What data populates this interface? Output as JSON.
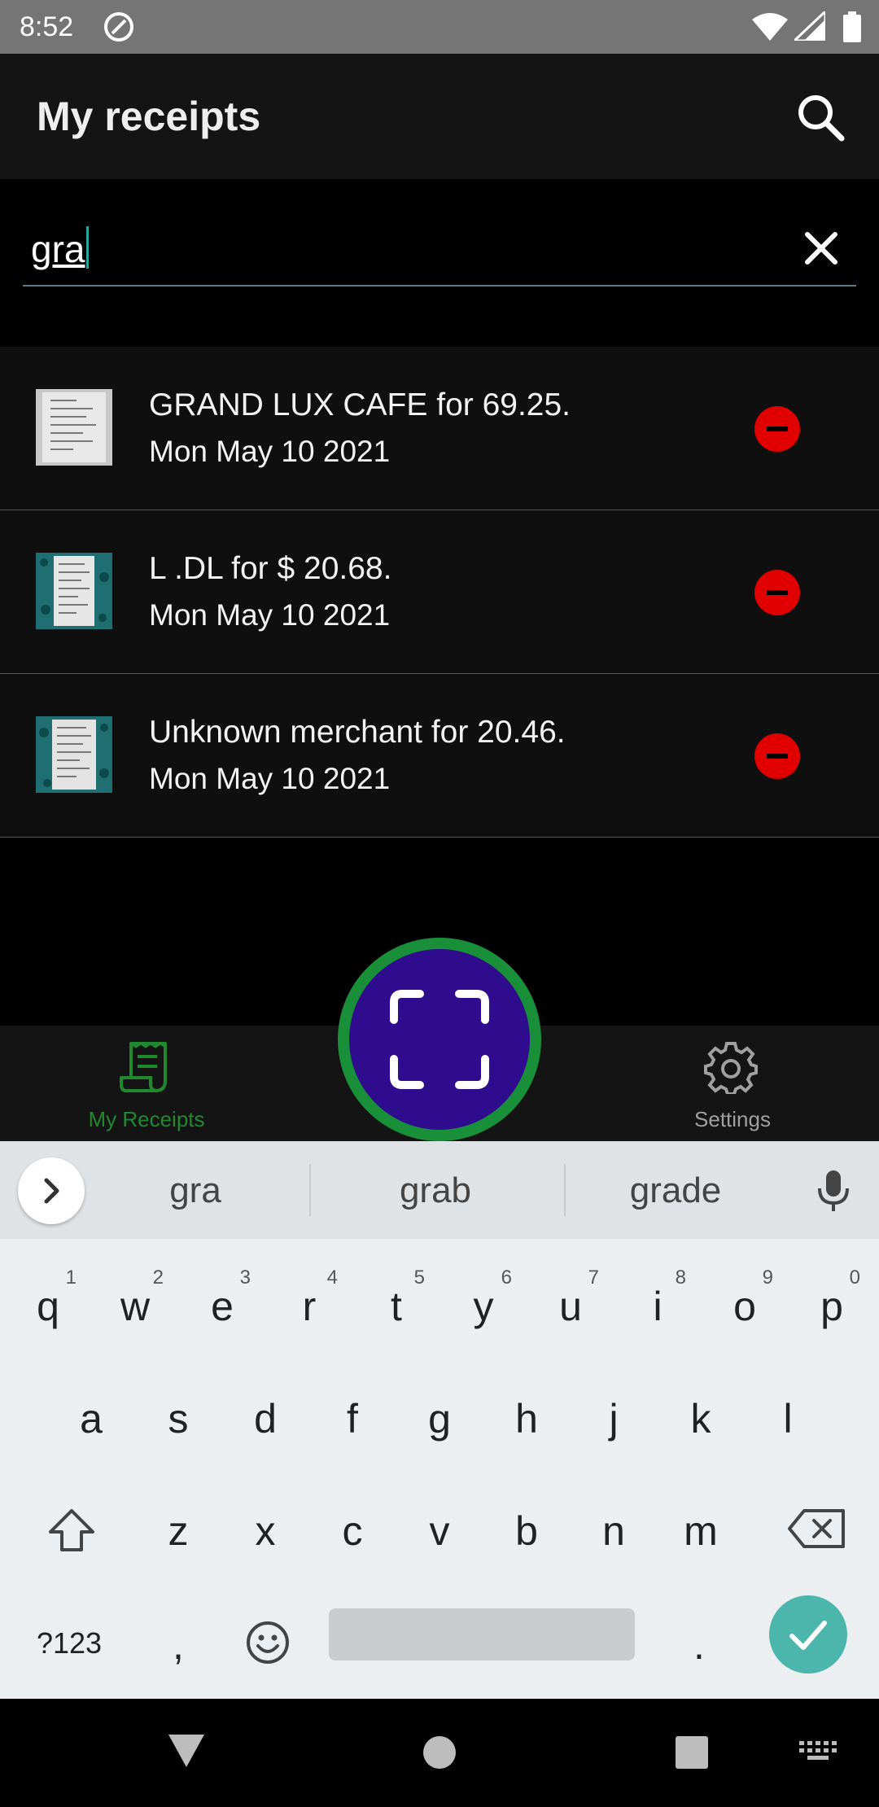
{
  "status_bar": {
    "time": "8:52",
    "icons": [
      "at-icon",
      "wifi-icon",
      "signal-icon",
      "battery-icon"
    ]
  },
  "app_bar": {
    "title": "My receipts",
    "search_icon": "search-icon"
  },
  "search": {
    "value": "gra",
    "clear_icon": "close-icon"
  },
  "receipts": [
    {
      "title": "GRAND LUX CAFE for 69.25.",
      "date": "Mon May 10 2021",
      "thumbnail": "receipt-thumbnail"
    },
    {
      "title": "L .DL for $ 20.68.",
      "date": "Mon May 10 2021",
      "thumbnail": "receipt-thumbnail"
    },
    {
      "title": "Unknown merchant for 20.46.",
      "date": "Mon May 10 2021",
      "thumbnail": "receipt-thumbnail"
    }
  ],
  "bottom_nav": {
    "receipts_label": "My Receipts",
    "settings_label": "Settings",
    "active": "My Receipts"
  },
  "keyboard": {
    "suggestions": [
      "gra",
      "grab",
      "grade"
    ],
    "row1": [
      {
        "ch": "q",
        "num": "1"
      },
      {
        "ch": "w",
        "num": "2"
      },
      {
        "ch": "e",
        "num": "3"
      },
      {
        "ch": "r",
        "num": "4"
      },
      {
        "ch": "t",
        "num": "5"
      },
      {
        "ch": "y",
        "num": "6"
      },
      {
        "ch": "u",
        "num": "7"
      },
      {
        "ch": "i",
        "num": "8"
      },
      {
        "ch": "o",
        "num": "9"
      },
      {
        "ch": "p",
        "num": "0"
      }
    ],
    "row2": [
      "a",
      "s",
      "d",
      "f",
      "g",
      "h",
      "j",
      "k",
      "l"
    ],
    "row3": [
      "z",
      "x",
      "c",
      "v",
      "b",
      "n",
      "m"
    ],
    "symbols_label": "?123",
    "comma": ",",
    "period": "."
  },
  "colors": {
    "accent_green": "#20882f",
    "fab_purple": "#2f0c8e",
    "delete_red": "#e00000",
    "enter_teal": "#4db6ac"
  }
}
